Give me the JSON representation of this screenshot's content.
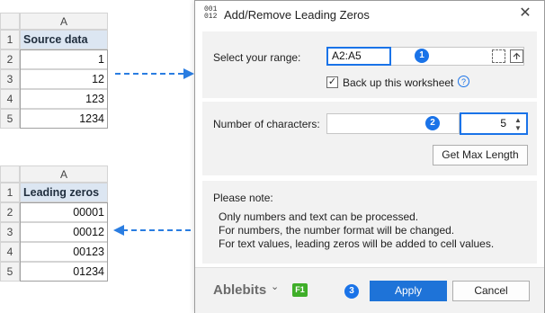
{
  "source_sheet": {
    "column_header": "A",
    "rows": [
      {
        "num": "1",
        "value": "Source data"
      },
      {
        "num": "2",
        "value": "1"
      },
      {
        "num": "3",
        "value": "12"
      },
      {
        "num": "4",
        "value": "123"
      },
      {
        "num": "5",
        "value": "1234"
      }
    ]
  },
  "result_sheet": {
    "column_header": "A",
    "rows": [
      {
        "num": "1",
        "value": "Leading zeros"
      },
      {
        "num": "2",
        "value": "00001"
      },
      {
        "num": "3",
        "value": "00012"
      },
      {
        "num": "4",
        "value": "00123"
      },
      {
        "num": "5",
        "value": "01234"
      }
    ]
  },
  "dialog": {
    "title_icon_top": "001",
    "title_icon_bottom": "012",
    "title": "Add/Remove Leading Zeros",
    "close_glyph": "✕",
    "range_label": "Select your range:",
    "range_value": "A2:A5",
    "backup_label": "Back up this worksheet",
    "backup_checked_glyph": "✓",
    "help_glyph": "?",
    "chars_label": "Number of characters:",
    "chars_value": "5",
    "max_length_button": "Get Max Length",
    "note_title": "Please note:",
    "note_lines": [
      "Only numbers and text can be processed.",
      "For numbers, the number format will be changed.",
      "For text values, leading zeros will be added to cell values."
    ],
    "brand": "Ablebits",
    "brand_chevron": "⌄",
    "f1_badge": "F1",
    "apply_button": "Apply",
    "cancel_button": "Cancel",
    "badges": [
      "1",
      "2",
      "3"
    ]
  },
  "colors": {
    "accent": "#1a73e8",
    "header_fill": "#dce6f2",
    "arrow": "#2a7de1",
    "f1_green": "#3fae29"
  }
}
